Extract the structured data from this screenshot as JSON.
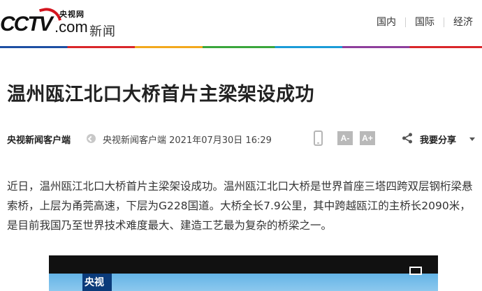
{
  "header": {
    "logo_cctv": "CCTV",
    "logo_com": ".com",
    "logo_cn": "央视网",
    "logo_section": "新闻",
    "nav": [
      "国内",
      "国际",
      "经济"
    ]
  },
  "article": {
    "title": "温州瓯江北口大桥首片主梁架设成功",
    "source_name": "央视新闻客户端",
    "source_info": "央视新闻客户端 2021年07月30日 16:29",
    "font_decrease": "A-",
    "font_increase": "A+",
    "share_label": "我要分享",
    "body": "近日，温州瓯江北口大桥首片主梁架设成功。温州瓯江北口大桥是世界首座三塔四跨双层钢桁梁悬索桥，上层为甬莞高速，下层为G228国道。大桥全长7.9公里，其中跨越瓯江的主桥长2090米，是目前我国乃至世界技术难度最大、建造工艺最为复杂的桥梁之一。"
  },
  "video": {
    "watermark": "央视"
  },
  "colors": {
    "brand_red": "#d4151f",
    "rainbow": [
      "#1d4fa3",
      "#d9262a",
      "#f2a81d",
      "#3aa63c",
      "#1a9bd7",
      "#8e3f9c"
    ]
  },
  "icons": [
    "clock-icon",
    "phone-icon",
    "share-icon",
    "fullscreen-icon"
  ]
}
